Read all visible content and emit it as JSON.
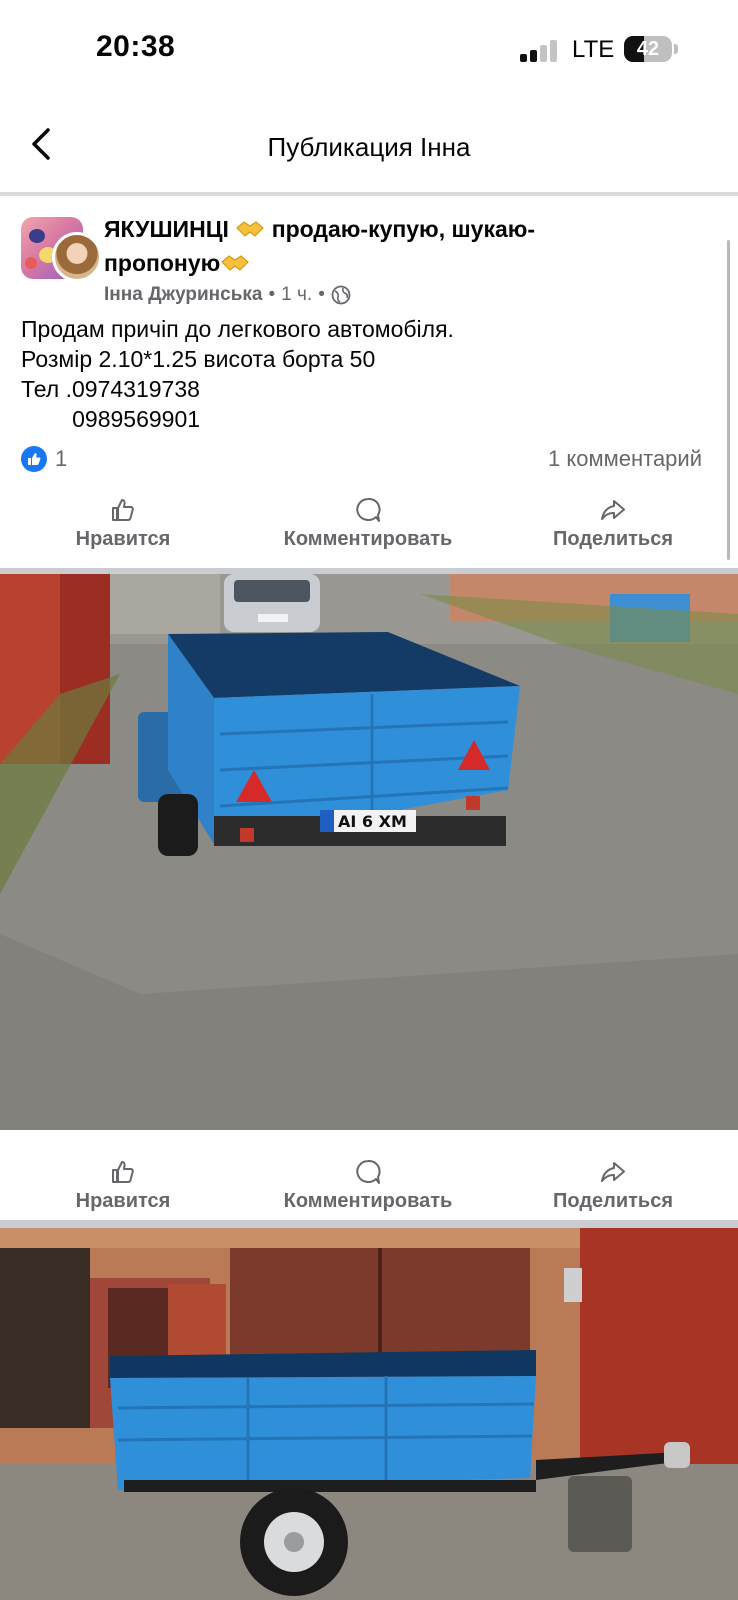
{
  "status_bar": {
    "time": "20:38",
    "network": "LTE",
    "battery": "42",
    "battery_level": 0.42
  },
  "nav": {
    "title": "Публикация Інна"
  },
  "post": {
    "group_name": "ЯКУШИНЦІ",
    "group_desc_1": "продаю-купую, шукаю-",
    "group_desc_2": "пропоную",
    "author": "Інна Джуринська",
    "time": "1 ч.",
    "text": "Продам причіп до легкового автомобіля.\nРозмір 2.10*1.25 висота борта 50\nТел .0974319738\n        0989569901",
    "like_count": "1",
    "comment_count": "1 комментарий"
  },
  "actions": {
    "like": "Нравится",
    "comment": "Комментировать",
    "share": "Поделиться"
  },
  "photos": {
    "photo1_plate": "AI  6 XM"
  },
  "icons": [
    "back-chevron-icon",
    "like-thumb-icon",
    "comment-bubble-icon",
    "share-arrow-icon",
    "globe-icon",
    "handshake-emoji-icon"
  ],
  "colors": {
    "accent": "#1877f2",
    "secondary_text": "#65676b",
    "trailer_blue": "#2f8fd8"
  }
}
